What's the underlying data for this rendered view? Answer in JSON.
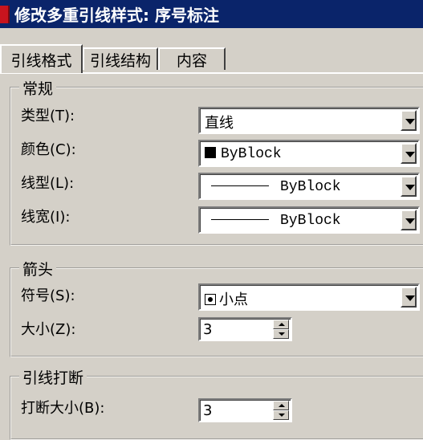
{
  "window": {
    "title": "修改多重引线样式: 序号标注"
  },
  "tabs": [
    {
      "label": "引线格式",
      "active": true
    },
    {
      "label": "引线结构",
      "active": false
    },
    {
      "label": "内容",
      "active": false
    }
  ],
  "general": {
    "title": "常规",
    "type_label": "类型(T):",
    "type_value": "直线",
    "color_label": "颜色(C):",
    "color_value": "ByBlock",
    "linetype_label": "线型(L):",
    "linetype_value": "ByBlock",
    "lineweight_label": "线宽(I):",
    "lineweight_value": "ByBlock"
  },
  "arrowhead": {
    "title": "箭头",
    "symbol_label": "符号(S):",
    "symbol_value": "小点",
    "size_label": "大小(Z):",
    "size_value": "3"
  },
  "leader_break": {
    "title": "引线打断",
    "break_size_label": "打断大小(B):",
    "break_size_value": "3"
  },
  "colors": {
    "titlebar": "#0a246a",
    "face": "#d4d0c8"
  }
}
